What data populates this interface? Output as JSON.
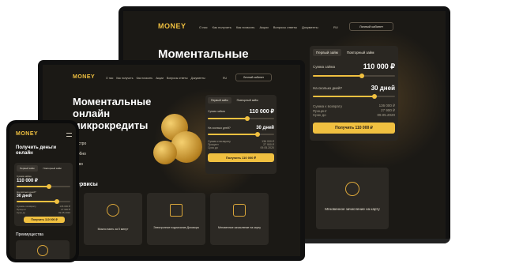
{
  "brand": {
    "logo": "MONEY",
    "accent": "#f0c040",
    "bg": "#1b1915"
  },
  "nav": {
    "items": [
      "О нас",
      "Как получить",
      "Как погасить",
      "Акции",
      "Вопросы ответы",
      "Документы"
    ],
    "lang": "RU",
    "cabinet": "Личный кабинет"
  },
  "hero": {
    "line1": "Моментальные",
    "line2": "онлайн",
    "line3": "микрокредиты"
  },
  "hero_points": [
    "Быстро",
    "Удобно",
    "Легко"
  ],
  "calc": {
    "tab_first": "Первый займ",
    "tab_repeat": "Повторный займ",
    "sum_label": "Сумма займа",
    "sum_value": "110 000 ₽",
    "sum_fraction": 0.6,
    "days_label": "На сколько дней?",
    "days_value": "30 дней",
    "days_fraction": 0.75,
    "summary": [
      {
        "k": "Сумма к возврату",
        "v": "136 000 ₽"
      },
      {
        "k": "Процент",
        "v": "27 900 ₽"
      },
      {
        "k": "Срок до",
        "v": "09.05.2020"
      }
    ],
    "button": "Получить 110 000 ₽"
  },
  "services": {
    "title": "Сервисы",
    "items": [
      "Можно взять за 5 минут",
      "Электронное подписание Договора",
      "Мгновенное зачисление на карту"
    ]
  },
  "mobile": {
    "hero": "Получить деньги онлайн",
    "advantages": "Преимущества"
  }
}
